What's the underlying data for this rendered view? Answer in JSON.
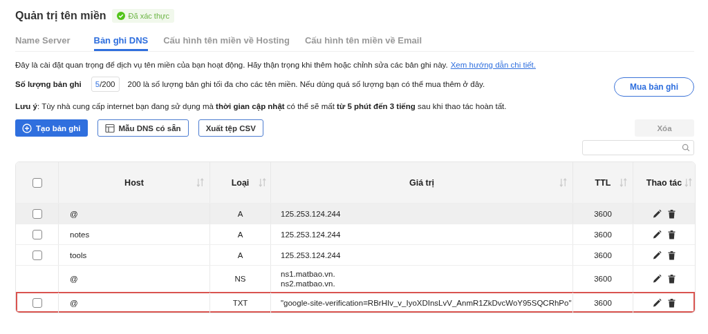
{
  "page": {
    "title": "Quản trị tên miền",
    "badge": "Đã xác thực"
  },
  "tabs": [
    {
      "label": "Name Server",
      "selected": false
    },
    {
      "label": "Bản ghi DNS",
      "selected": true
    },
    {
      "label": "Cấu hình tên miền về Hosting",
      "selected": false
    },
    {
      "label": "Cấu hình tên miền về Email",
      "selected": false
    }
  ],
  "intro": {
    "text": "Đây là cài đặt quan trọng để dịch vụ tên miền của bạn hoạt động. Hãy thận trọng khi thêm hoặc chỉnh sửa các bản ghi này.",
    "link": "Xem hướng dẫn chi tiết."
  },
  "quota": {
    "label": "Số lượng bản ghi",
    "used": "5",
    "total": "/200",
    "note": "200 là số lượng bản ghi tối đa cho các tên miền. Nếu dùng quá số lượng bạn có thể mua thêm ở đây.",
    "button": "Mua bản ghi"
  },
  "notice": "**Lưu ý**: Tùy nhà cung cấp internet bạn đang sử dụng mà **thời gian cập nhật** có thể sẽ mất **từ 5 phút đến 3 tiếng** sau khi thao tác hoàn tất.",
  "toolbar": {
    "create": "Tạo bản ghi",
    "templates": "Mẫu DNS có sẵn",
    "export": "Xuất tệp CSV",
    "delete": {
      "label": "Xóa",
      "disabled": true
    }
  },
  "table": {
    "select_all_checked": false,
    "columns": [
      "Host",
      "Loại",
      "Giá trị",
      "TTL",
      "Thao tác"
    ],
    "rows": [
      {
        "host": "@",
        "type": "A",
        "values": [
          "125.253.124.244"
        ],
        "ttl": "3600",
        "checked": false,
        "hovered": true,
        "outlined": false
      },
      {
        "host": "notes",
        "type": "A",
        "values": [
          "125.253.124.244"
        ],
        "ttl": "3600",
        "checked": false,
        "hovered": false,
        "outlined": false
      },
      {
        "host": "tools",
        "type": "A",
        "values": [
          "125.253.124.244"
        ],
        "ttl": "3600",
        "checked": false,
        "hovered": false,
        "outlined": false
      },
      {
        "host": "@",
        "type": "NS",
        "values": [
          "ns1.matbao.vn.",
          "ns2.matbao.vn."
        ],
        "ttl": "3600",
        "hovered": false,
        "outlined": false
      },
      {
        "host": "@",
        "type": "TXT",
        "values": [
          "\"google-site-verification=RBrHIv_v_IyoXDInsLvV_AnmR1ZkDvcWoY95SQCRhPo\""
        ],
        "ttl": "3600",
        "checked": false,
        "hovered": false,
        "outlined": true
      }
    ]
  }
}
